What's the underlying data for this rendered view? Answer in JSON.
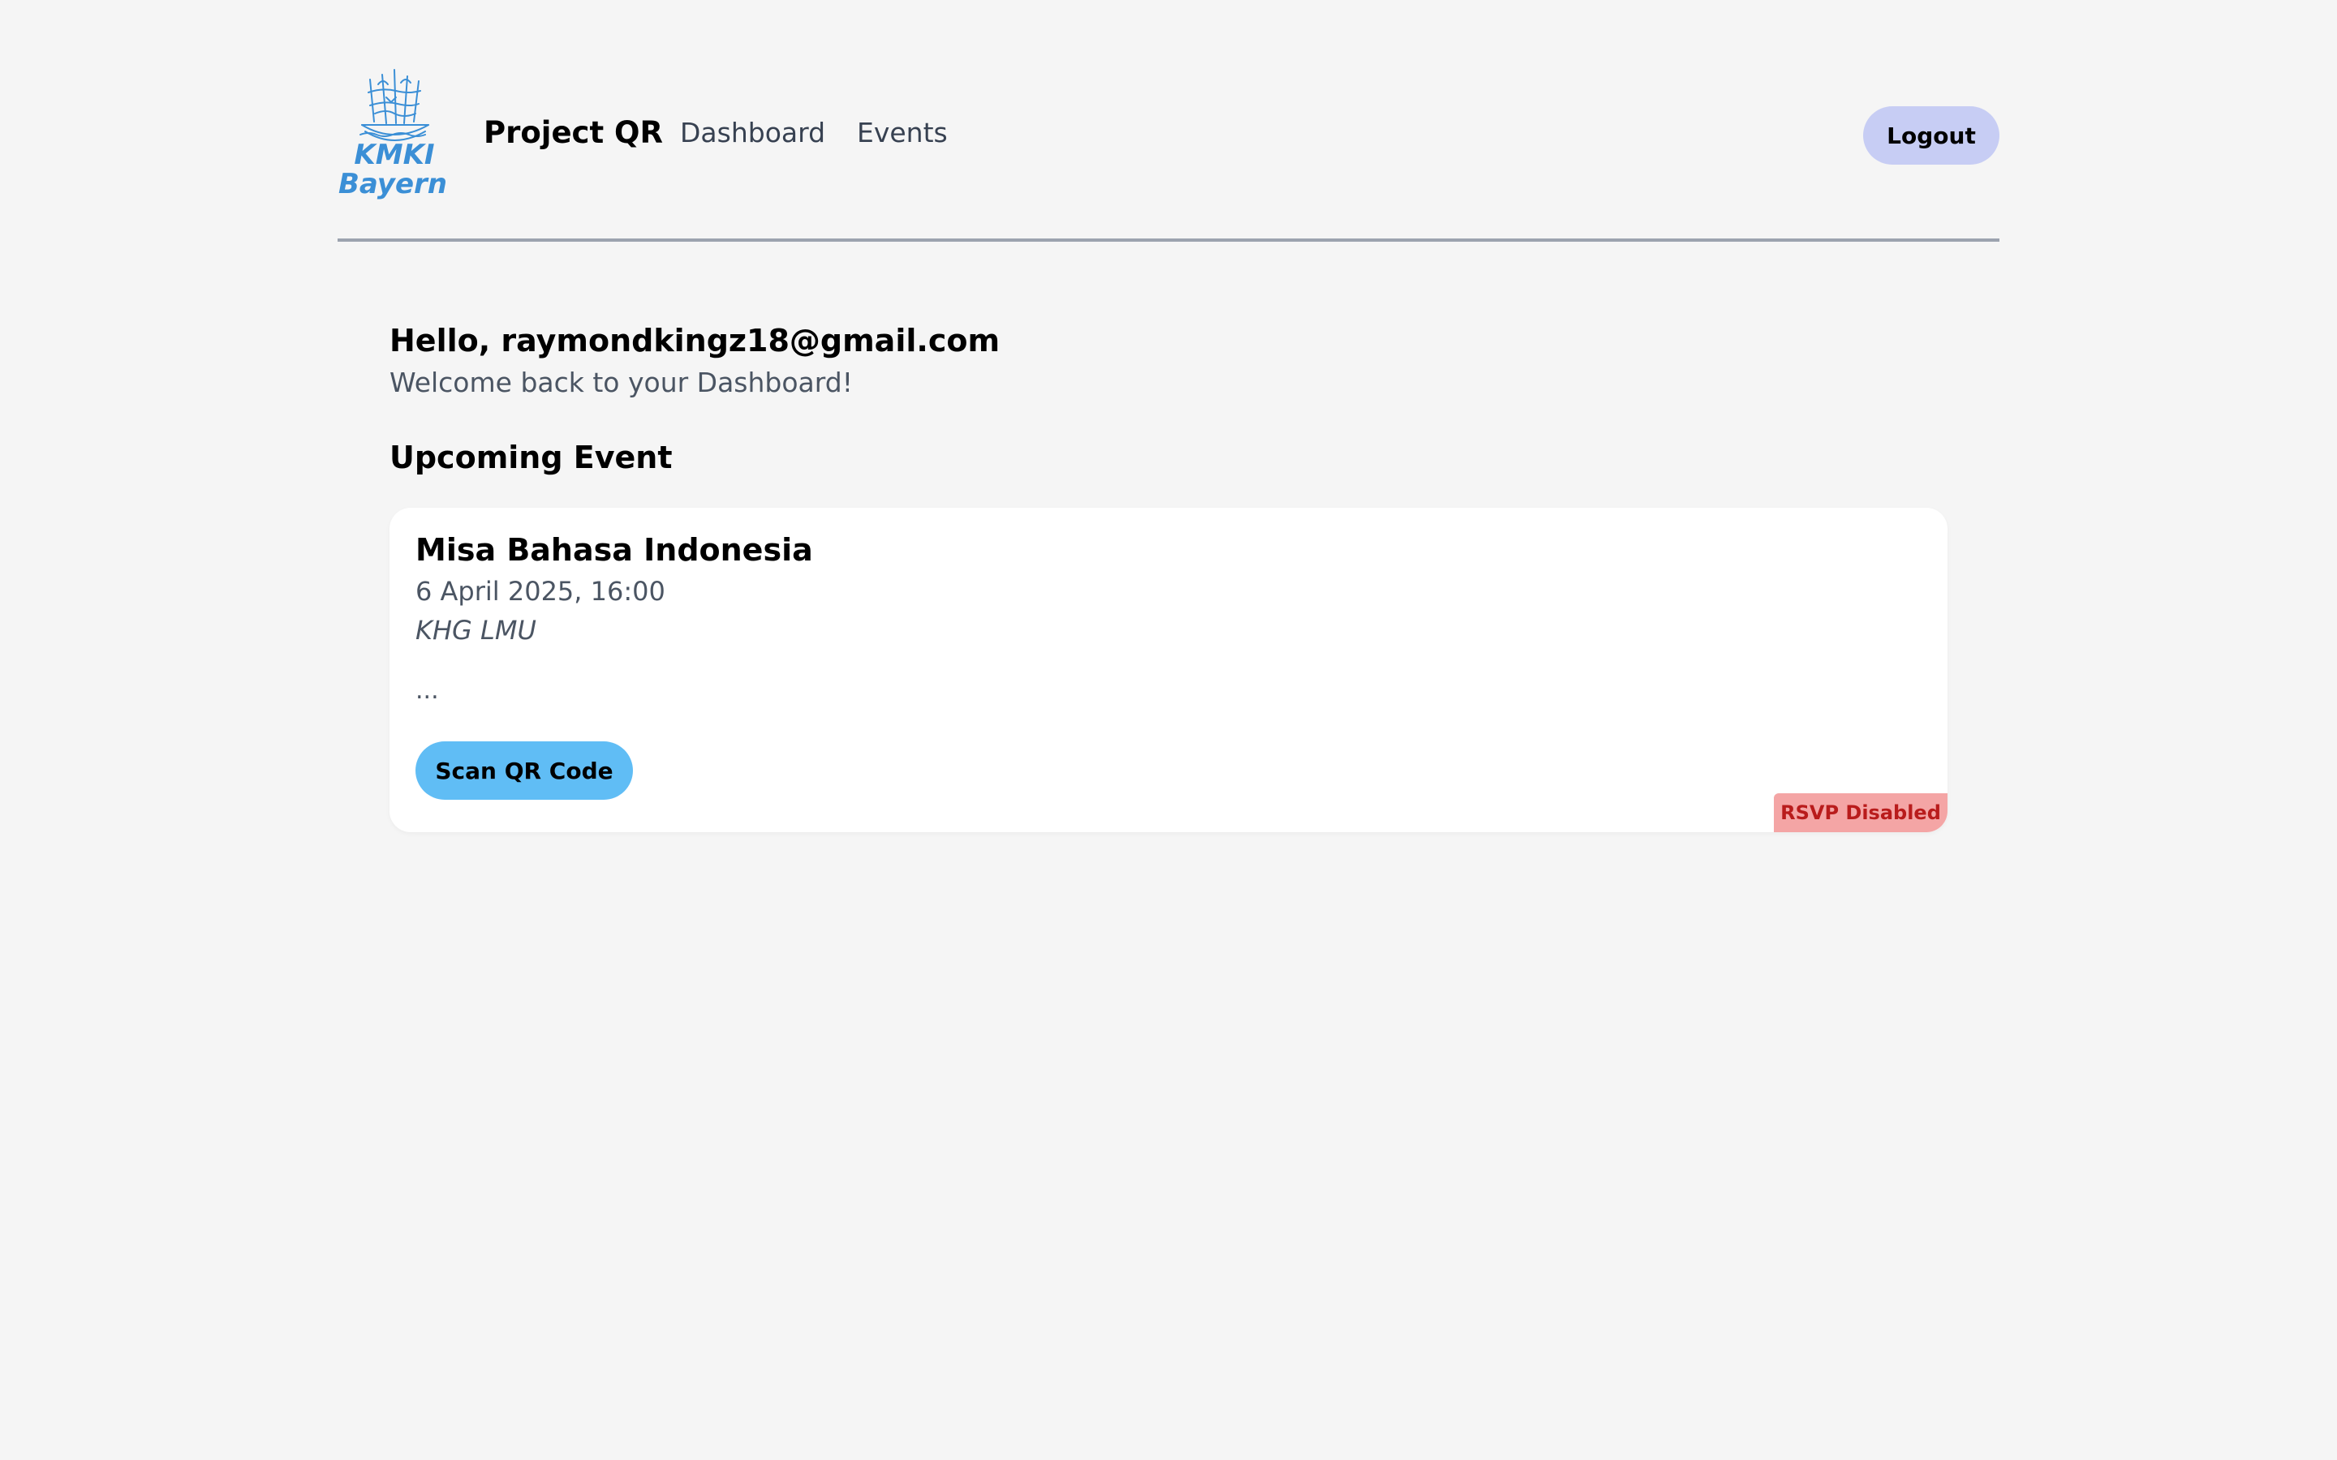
{
  "header": {
    "logo_text_line1": "KMKI",
    "logo_text_line2": "Bayern",
    "brand": "Project QR",
    "nav": [
      {
        "label": "Dashboard"
      },
      {
        "label": "Events"
      }
    ],
    "logout_label": "Logout"
  },
  "main": {
    "greeting": "Hello, raymondkingz18@gmail.com",
    "welcome": "Welcome back to your Dashboard!",
    "section_title": "Upcoming Event",
    "event": {
      "title": "Misa Bahasa Indonesia",
      "date": "6 April 2025, 16:00",
      "location": "KHG LMU",
      "description": "...",
      "scan_button_label": "Scan QR Code",
      "rsvp_status": "RSVP Disabled"
    }
  },
  "colors": {
    "background": "#f5f5f5",
    "logout_button": "#c7cdf4",
    "scan_button": "#60bdf5",
    "rsvp_badge_bg": "#f4a5a5",
    "rsvp_badge_text": "#b91c1c",
    "logo_blue": "#3b8fd6"
  }
}
